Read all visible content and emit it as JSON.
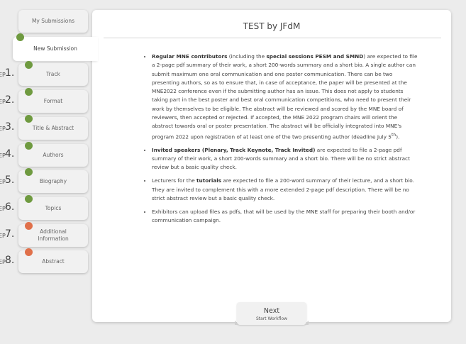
{
  "nav": {
    "my_submissions": "My Submissions",
    "new_submission": "New Submission",
    "step_prefix": "EP",
    "steps": [
      {
        "num": "1.",
        "label": "Track",
        "status": "done"
      },
      {
        "num": "2.",
        "label": "Format",
        "status": "done"
      },
      {
        "num": "3.",
        "label": "Title & Abstract",
        "status": "done"
      },
      {
        "num": "4.",
        "label": "Authors",
        "status": "done"
      },
      {
        "num": "5.",
        "label": "Biography",
        "status": "done"
      },
      {
        "num": "6.",
        "label": "Topics",
        "status": "done"
      },
      {
        "num": "7.",
        "label": "Additional Information",
        "status": "pending"
      },
      {
        "num": "8.",
        "label": "Abstract",
        "status": "pending"
      }
    ]
  },
  "colors": {
    "done": "#6f9a40",
    "pending": "#e0704a"
  },
  "panel": {
    "title": "TEST by JFdM",
    "bullets": [
      {
        "b1": "Regular MNE contributors",
        "t1": " (including the ",
        "b2": "special sessions PESM and SMND",
        "t2": ") are expected to file a 2-page pdf summary of their work, a short 200-words summary and a short bio. A single author can submit maximum one oral communication and one poster communication. There can be two presenting authors, so as to ensure that, in case of acceptance, the paper will be presented at the MNE2022 conference even if the submitting author has an issue. This does not apply to students taking part in the best poster and best oral communication competitions, who need to present their work by themselves to be eligible. The abstract will be reviewed and scored by the MNE board of reviewers, then accepted or rejected. If accepted, the MNE 2022 program chairs will orient the abstract towards oral or poster presentation. The abstract will be officially integrated into MNE's program 2022 upon registration of at least one of the two presenting author (deadline July 5",
        "sup": "th",
        "t3": ")."
      },
      {
        "b1": "Invited speakers (Plenary, Track Keynote, Track Invited)",
        "t1": " are expected to file a 2-page pdf summary of their work, a short 200-words summary and a short bio. There will be no strict abstract review but a basic quality check."
      },
      {
        "t0": "Lecturers for the ",
        "b1": "tutorials",
        "t1": " are expected to file a 200-word summary of their lecture, and a short bio. They are invited to complement this with a more extended 2-page pdf description. There will be no strict abstract review but a basic quality check."
      },
      {
        "t0": "Exhibitors can upload files as pdfs, that will be used by the MNE staff for preparing their booth and/or communication campaign."
      }
    ]
  },
  "next": {
    "label": "Next",
    "sub": "Start Workflow"
  }
}
